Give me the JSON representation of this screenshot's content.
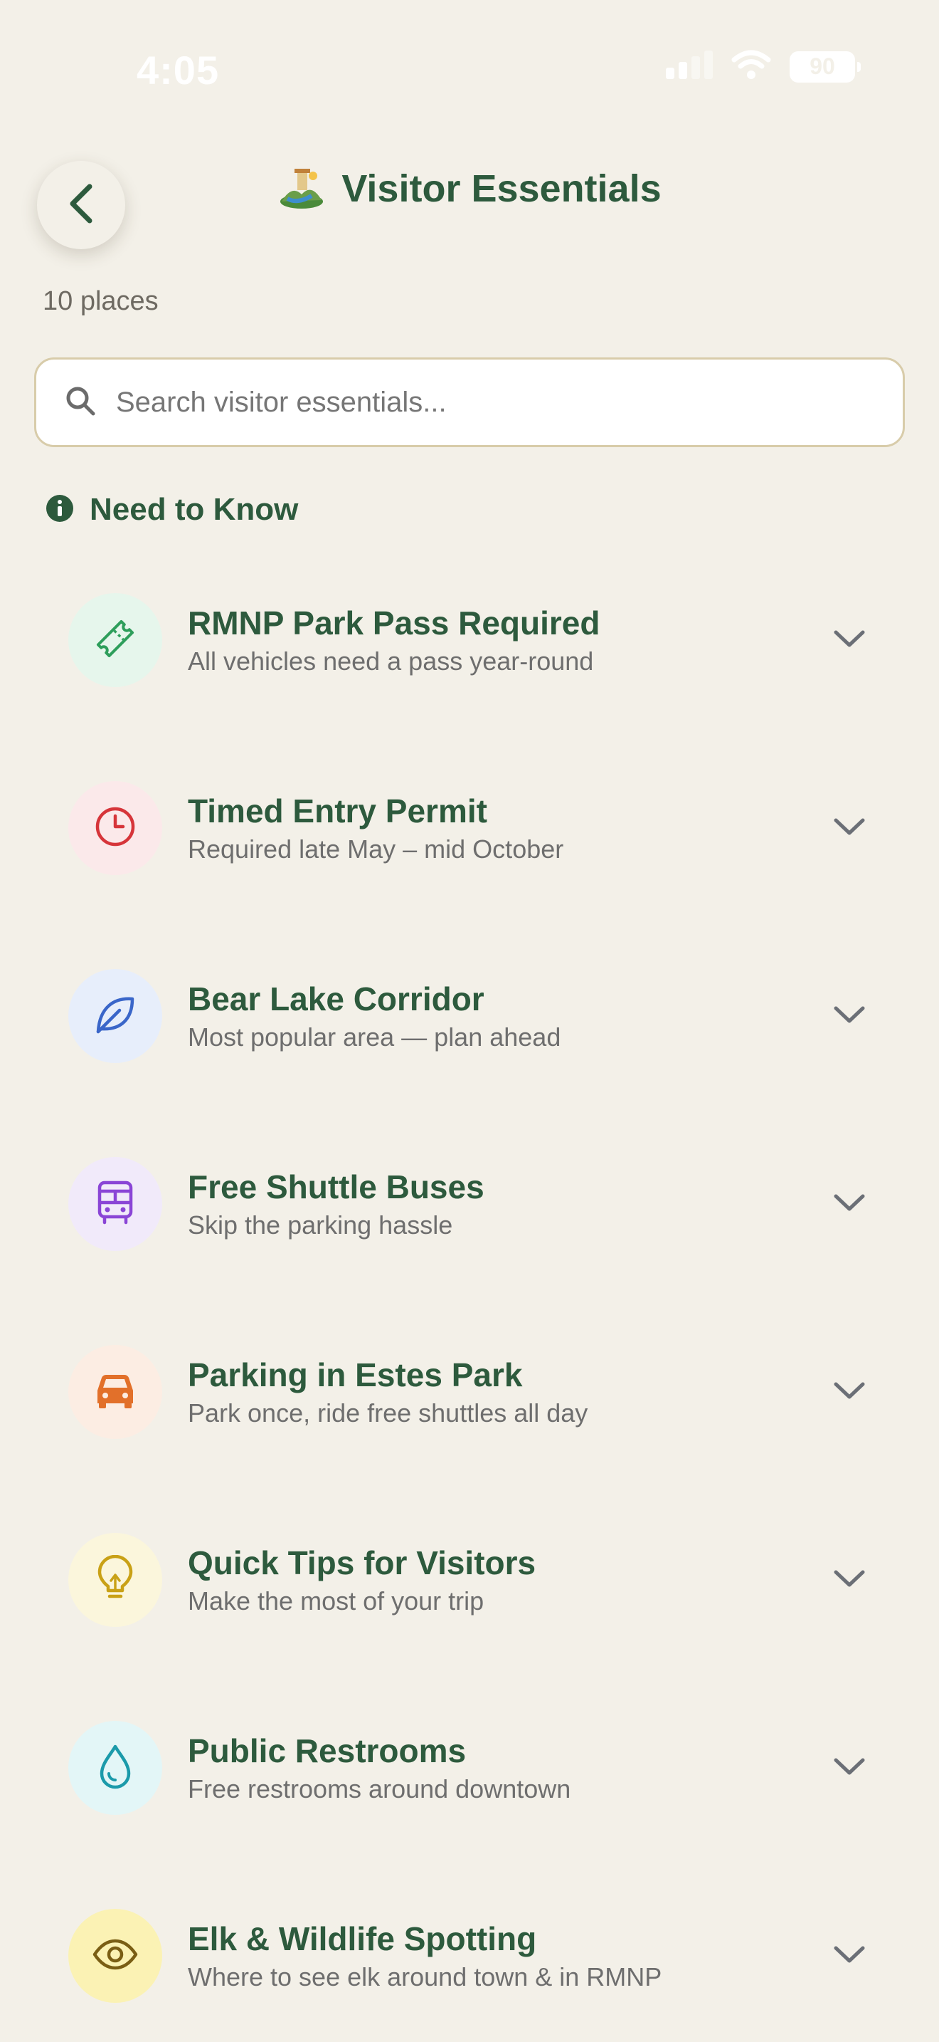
{
  "status_bar": {
    "time": "4:05",
    "battery": "90"
  },
  "header": {
    "title": "Visitor Essentials",
    "subtitle": "10 places"
  },
  "search": {
    "placeholder": "Search visitor essentials...",
    "value": ""
  },
  "section": {
    "title": "Need to Know"
  },
  "items": [
    {
      "title": "RMNP Park Pass Required",
      "subtitle": "All vehicles need a pass year-round",
      "icon": "ticket-icon",
      "color": "#2e9e5b",
      "bg": "#e6f6ec"
    },
    {
      "title": "Timed Entry Permit",
      "subtitle": "Required late May – mid October",
      "icon": "clock-icon",
      "color": "#d6353a",
      "bg": "#fbe9ea"
    },
    {
      "title": "Bear Lake Corridor",
      "subtitle": "Most popular area — plan ahead",
      "icon": "leaf-icon",
      "color": "#3a66c9",
      "bg": "#e7eefb"
    },
    {
      "title": "Free Shuttle Buses",
      "subtitle": "Skip the parking hassle",
      "icon": "bus-icon",
      "color": "#8a45d6",
      "bg": "#f1eafa"
    },
    {
      "title": "Parking in Estes Park",
      "subtitle": "Park once, ride free shuttles all day",
      "icon": "car-icon",
      "color": "#e2702a",
      "bg": "#fcede3"
    },
    {
      "title": "Quick Tips for Visitors",
      "subtitle": "Make the most of your trip",
      "icon": "lightbulb-icon",
      "color": "#c9a116",
      "bg": "#fbf6dc"
    },
    {
      "title": "Public Restrooms",
      "subtitle": "Free restrooms around downtown",
      "icon": "droplet-icon",
      "color": "#1b9aaa",
      "bg": "#e3f6f7"
    },
    {
      "title": "Elk & Wildlife Spotting",
      "subtitle": "Where to see elk around town & in RMNP",
      "icon": "eye-icon",
      "color": "#7a5e14",
      "bg": "#fbf2b4"
    }
  ]
}
